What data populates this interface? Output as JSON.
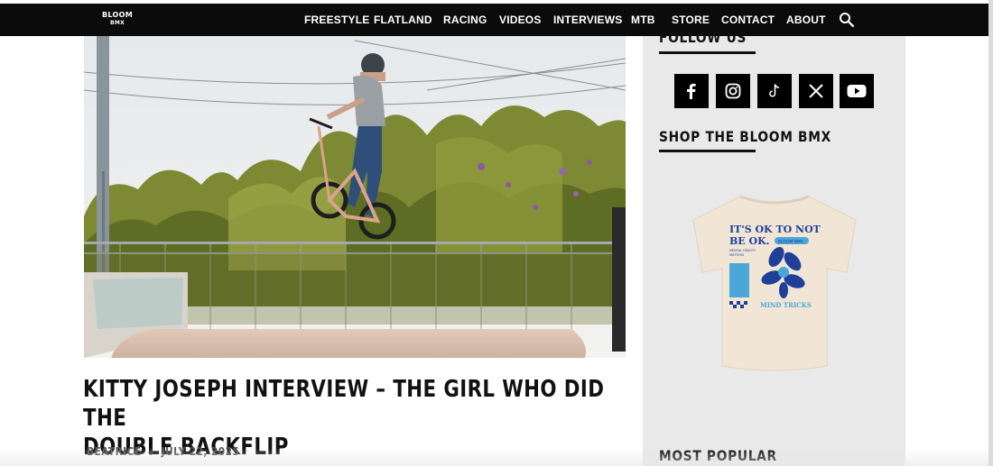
{
  "header": {
    "logo_line1": "BLOOM",
    "logo_line2": "BMX",
    "nav": [
      "FREESTYLE",
      "FLATLAND",
      "RACING",
      "VIDEOS",
      "INTERVIEWS",
      "MTB",
      "STORE",
      "CONTACT",
      "ABOUT"
    ],
    "search_icon": "search-icon"
  },
  "article": {
    "title_line1": "KITTY JOSEPH INTERVIEW – THE GIRL WHO DID THE",
    "title_line2": "DOUBLE BACKFLIP",
    "author": "BEATRICE",
    "date": "JULY 22, 2025"
  },
  "sidebar": {
    "follow_heading": "FOLLOW US",
    "socials": [
      "facebook-icon",
      "instagram-icon",
      "tiktok-icon",
      "x-icon",
      "youtube-icon"
    ],
    "shop_heading": "SHOP THE BLOOM BMX",
    "tshirt": {
      "line1": "IT'S OK TO NOT",
      "line2": "BE OK.",
      "badge": "BLOOM BMX",
      "small1": "MENTAL HEALTH",
      "small2": "MATTERS",
      "footer": "MIND TRICKS"
    },
    "popular_heading": "MOST POPULAR"
  },
  "colors": {
    "header_bg": "#0b0b0b",
    "sidebar_bg": "#e9e9e9",
    "shirt_blue": "#1f3f9a",
    "shirt_light_blue": "#4aa7d8"
  }
}
